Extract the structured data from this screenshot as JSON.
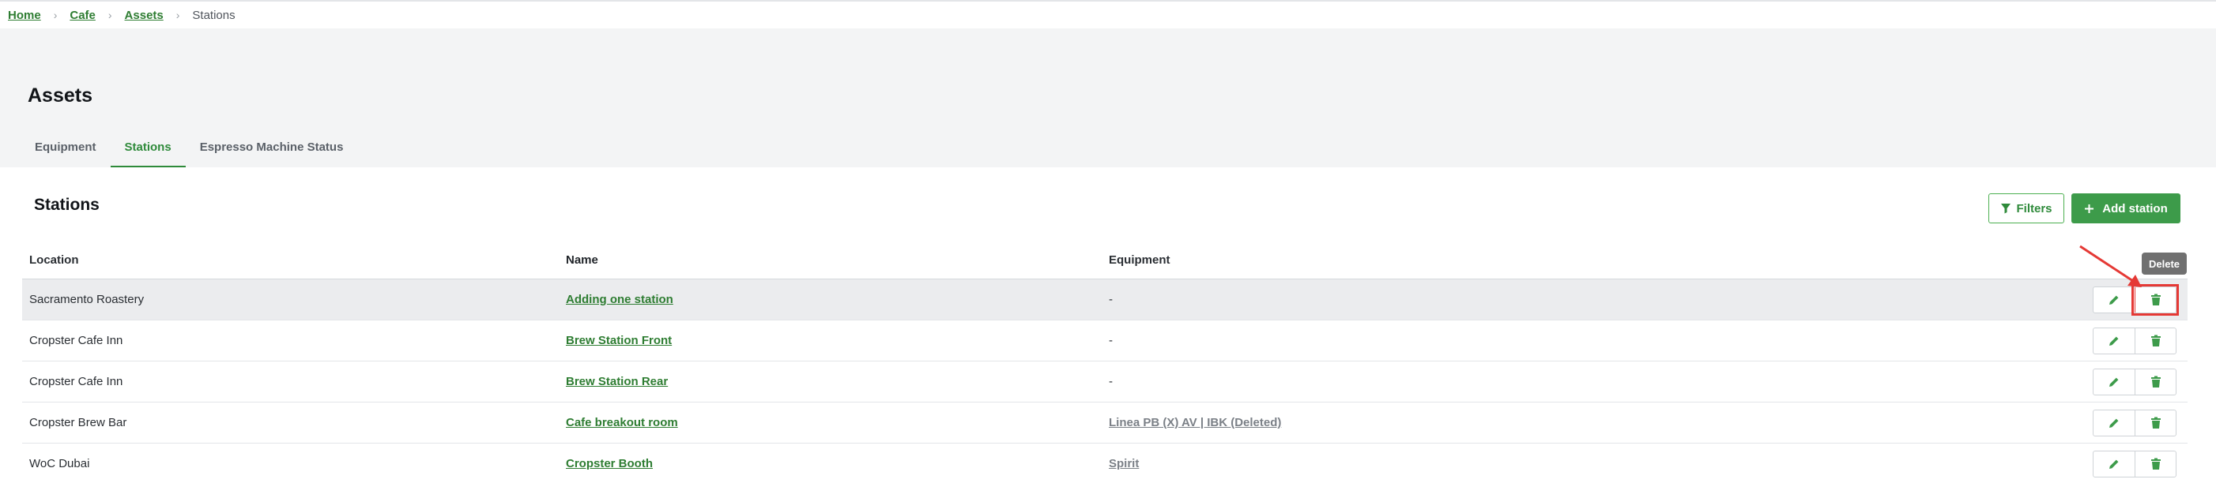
{
  "breadcrumb": {
    "items": [
      "Home",
      "Cafe",
      "Assets"
    ],
    "current": "Stations",
    "separator": "›"
  },
  "page": {
    "title": "Assets"
  },
  "tabs": [
    {
      "label": "Equipment",
      "active": false
    },
    {
      "label": "Stations",
      "active": true
    },
    {
      "label": "Espresso Machine Status",
      "active": false
    }
  ],
  "section": {
    "title": "Stations",
    "filters_label": "Filters",
    "add_label": "Add station"
  },
  "table": {
    "headers": {
      "location": "Location",
      "name": "Name",
      "equipment": "Equipment"
    },
    "rows": [
      {
        "location": "Sacramento Roastery",
        "name": "Adding one station",
        "equipment": "-"
      },
      {
        "location": "Cropster Cafe Inn",
        "name": "Brew Station Front",
        "equipment": "-"
      },
      {
        "location": "Cropster Cafe Inn",
        "name": "Brew Station Rear",
        "equipment": "-"
      },
      {
        "location": "Cropster Brew Bar",
        "name": "Cafe breakout room",
        "equipment": "Linea PB (X) AV | IBK (Deleted)"
      },
      {
        "location": "WoC Dubai",
        "name": "Cropster Booth",
        "equipment": "Spirit"
      }
    ]
  },
  "tooltip": {
    "text": "Delete"
  },
  "colors": {
    "brand_green": "#3d9b4a",
    "link_green": "#2e7d32",
    "annotation_red": "#e53935",
    "header_bg": "#f3f4f5"
  },
  "icons": {
    "edit": "pencil-icon",
    "delete": "trash-icon",
    "filter": "funnel-icon",
    "add": "plus-icon"
  }
}
